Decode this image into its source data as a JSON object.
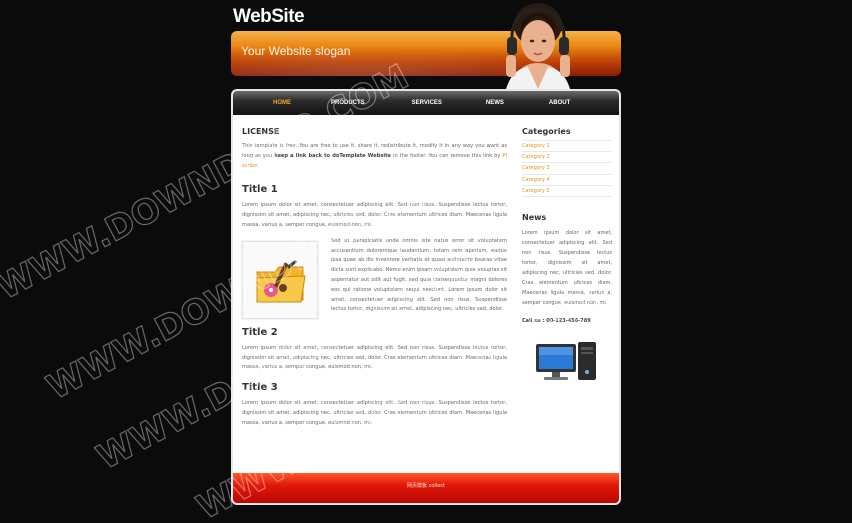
{
  "site": {
    "title": "WebSite"
  },
  "banner": {
    "slogan": "Your Website slogan"
  },
  "nav": {
    "items": [
      "HOME",
      "PRODUCTS",
      "SERVICES",
      "NEWS",
      "ABOUT"
    ],
    "active_index": 0
  },
  "license": {
    "heading": "LICENSE",
    "text_1": "This template is free. You are free to use it, share it, redistribute it, modify it in any way you want as long as you ",
    "text_bold": "keep a link back to doTemplate Website",
    "text_2": " in the footer. You can remove this link by ",
    "link": "PI scribe."
  },
  "sections": [
    {
      "title": "Title 1",
      "text": "Lorem ipsum dolor sit amet, consectetuer adipiscing elit. Sed non risus. Suspendisse lectus tortor, dignissim sit amet, adipiscing nec, ultricies sed, dolor. Cras elementum ultrices diam. Maecenas ligula massa, varius a, semper congue, euismod non, mi."
    },
    {
      "title": "Title 2",
      "text": "Lorem ipsum dolor sit amet, consectetuer adipiscing elit. Sed non risus. Suspendisse lectus tortor, dignissim sit amet, adipiscing nec, ultricies sed, dolor. Cras elementum ultrices diam. Maecenas ligula massa, varius a, semper congue, euismod non, mi."
    },
    {
      "title": "Title 3",
      "text": "Lorem ipsum dolor sit amet, consectetuer adipiscing elit. Sed non risus. Suspendisse lectus tortor, dignissim sit amet, adipiscing nec, ultricies sed, dolor. Cras elementum ultrices diam. Maecenas ligula massa, varius a, semper congue, euismod non, mi."
    }
  ],
  "feature_text": "Sed ut perspiciatis unde omnis iste natus error sit voluptatem accusantium doloremque laudantium, totam rem aperiam, eaque ipsa quae ab illo inventore veritatis et quasi architecto beatae vitae dicta sunt explicabo. Nemo enim ipsam voluptatem quia voluptas sit aspernatur aut odit aut fugit, sed quia consequuntur magni dolores eos qui ratione voluptatem sequi nesciunt. Lorem ipsum dolor sit amet, consectetuer adipiscing elit. Sed non risus. Suspendisse lectus tortor, dignissim sit amet, adipiscing nec, ultricies sed, dolor.",
  "sidebar": {
    "categories_heading": "Categories",
    "categories": [
      "Category 1",
      "Category 2",
      "Category 3",
      "Category 4",
      "Category 5"
    ],
    "news_heading": "News",
    "news_text": "Lorem ipsum dolor sit amet, consectetuer adipiscing elit. Sed non risus. Suspendisse lectus tortor, dignissim sit amet, adipiscing nec, ultricies sed, dolor. Cras elementum ultrices diam. Maecenas ligula massa, varius a, semper congue, euismod non, mi.",
    "call_text": "Call us : 00-123-456-789"
  },
  "footer": {
    "text": "网页模板 collect"
  },
  "watermark": {
    "text": "WWW.DOWNDEMO.COM"
  },
  "colors": {
    "accent": "#e0951a",
    "nav_active": "#f5a623",
    "footer_red": "#e21a0a",
    "banner_orange": "#e98512"
  }
}
